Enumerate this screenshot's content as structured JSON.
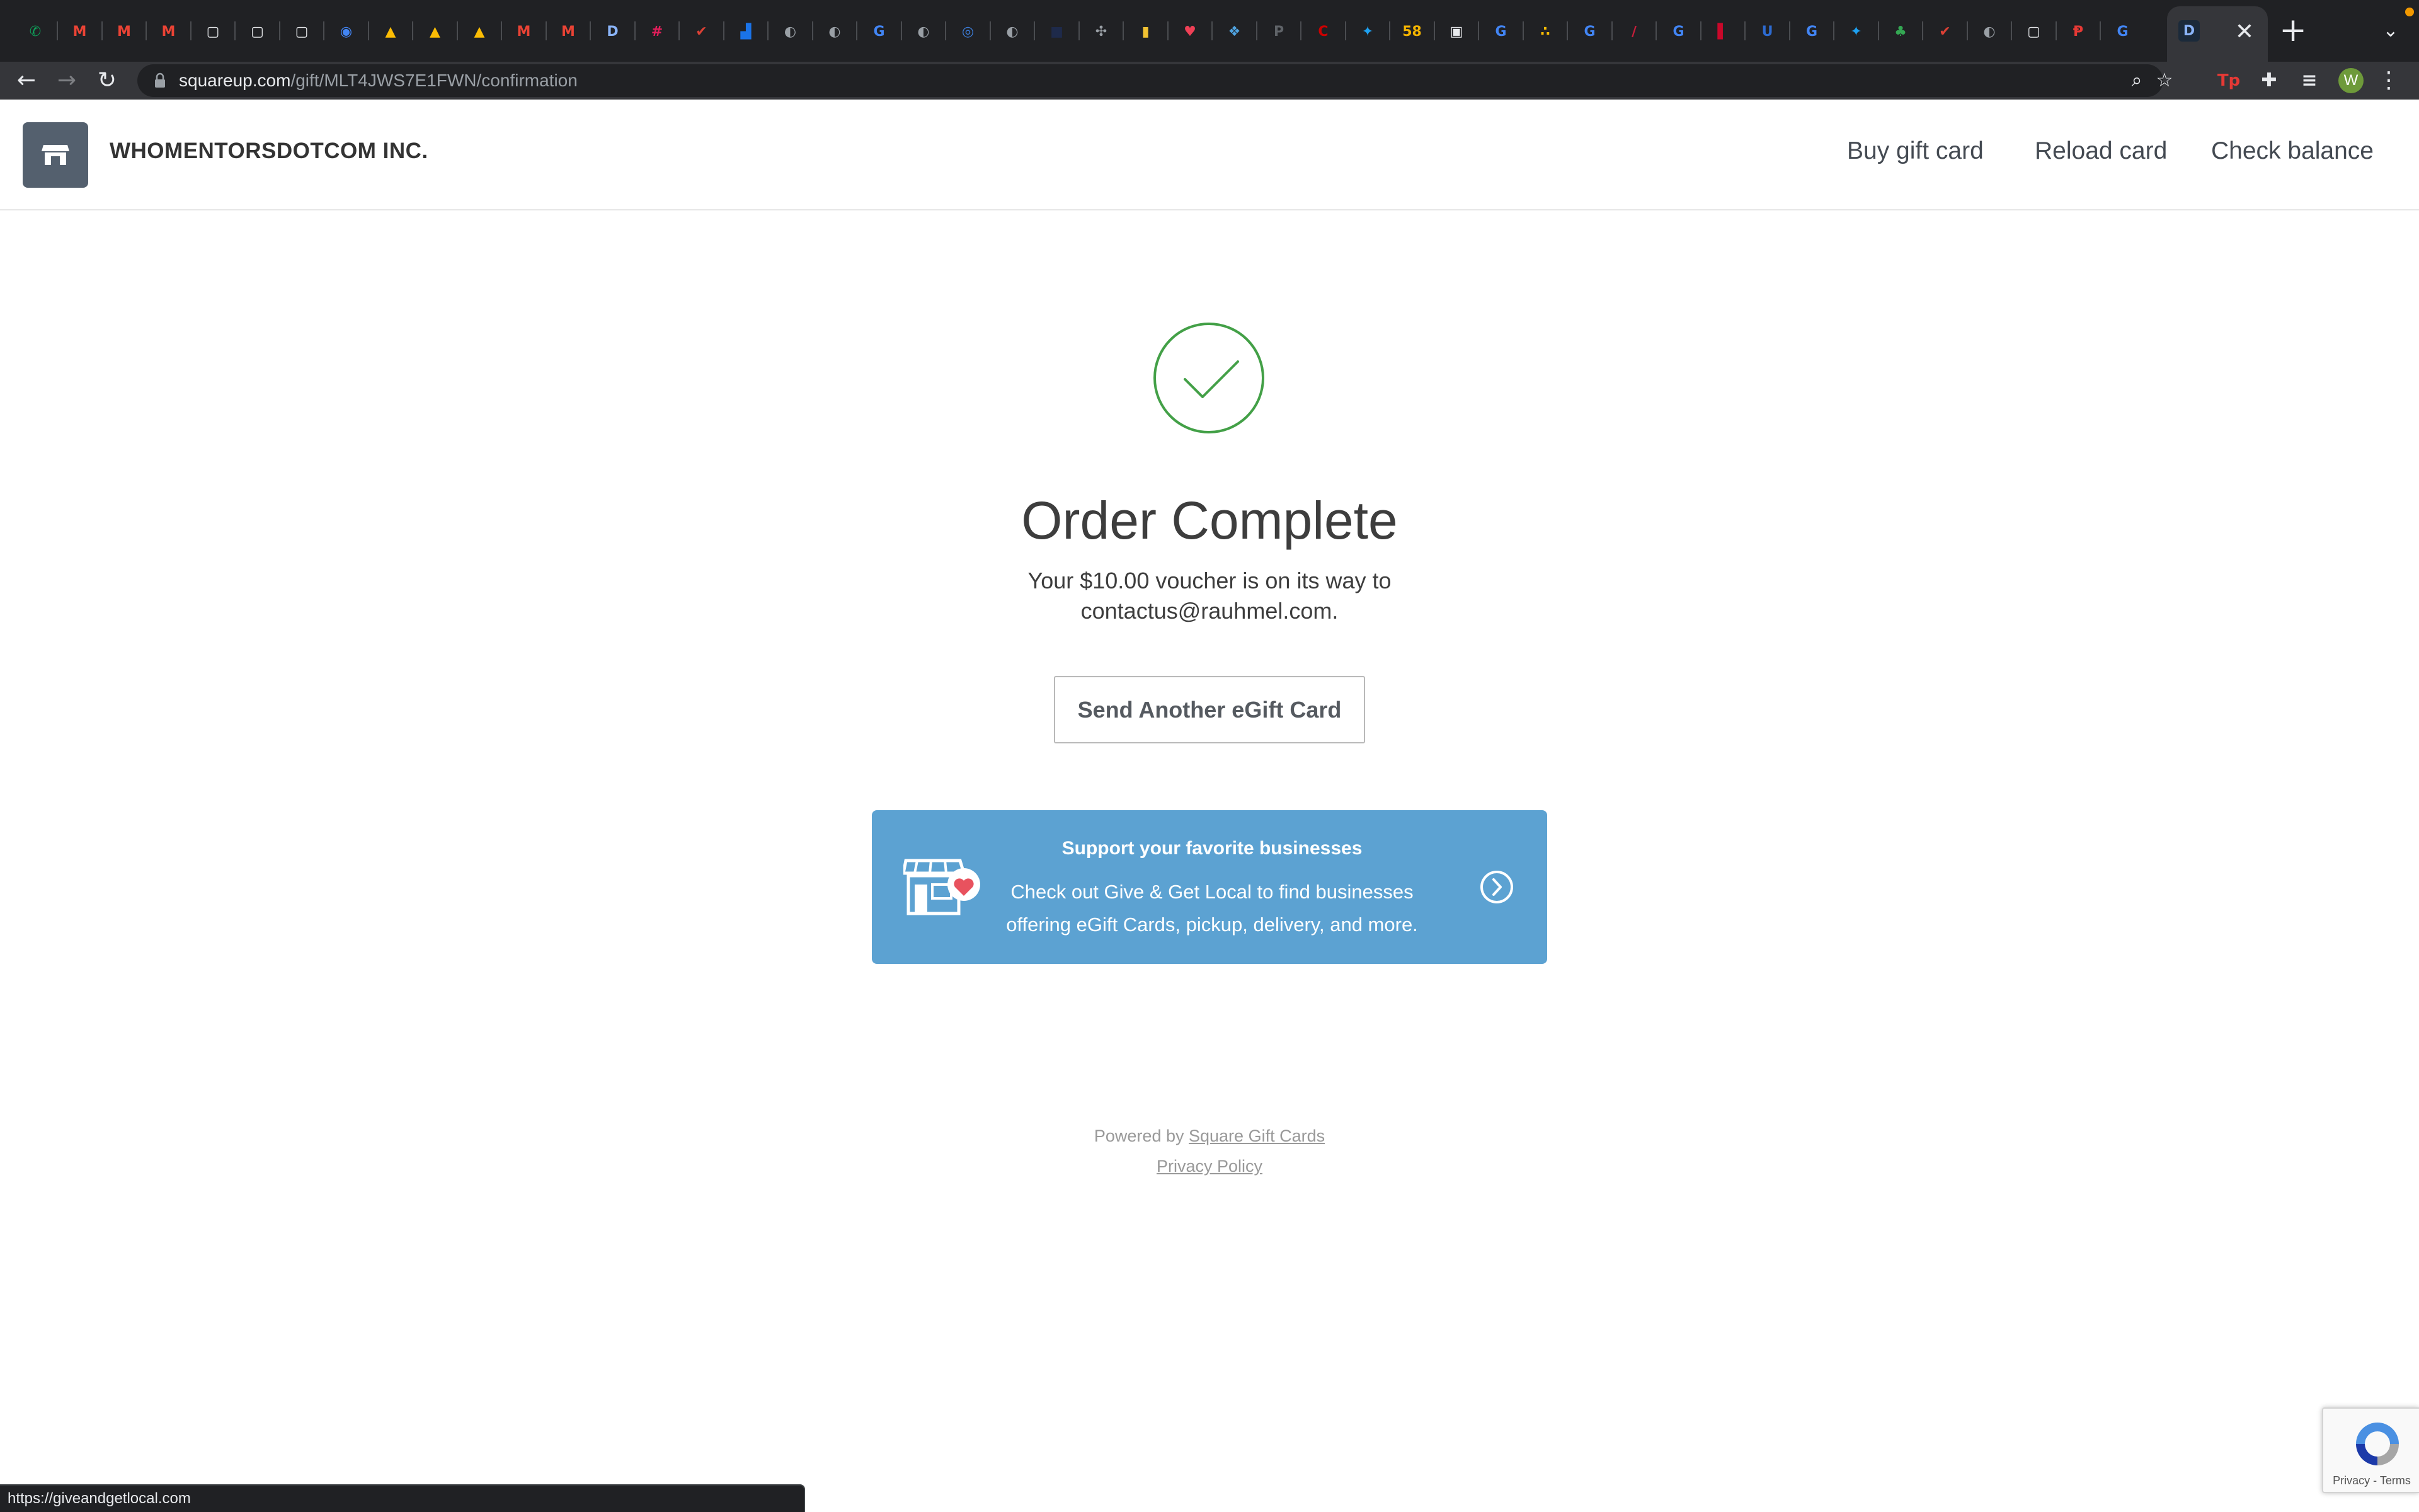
{
  "browser": {
    "tabs": [
      {
        "icon": "phone-icon",
        "glyph": "✆",
        "color": "#0f9d58"
      },
      {
        "icon": "gmail-icon",
        "glyph": "M",
        "color": "#ea4335"
      },
      {
        "icon": "gmail-icon",
        "glyph": "M",
        "color": "#ea4335"
      },
      {
        "icon": "gmail-icon",
        "glyph": "M",
        "color": "#ea4335"
      },
      {
        "icon": "square-icon",
        "glyph": "▢",
        "color": "#e8eaed"
      },
      {
        "icon": "square-icon",
        "glyph": "▢",
        "color": "#e8eaed"
      },
      {
        "icon": "square-icon",
        "glyph": "▢",
        "color": "#e8eaed"
      },
      {
        "icon": "chromium-icon",
        "glyph": "◉",
        "color": "#4285f4"
      },
      {
        "icon": "drive-icon",
        "glyph": "▲",
        "color": "#fbbc04"
      },
      {
        "icon": "drive-icon",
        "glyph": "▲",
        "color": "#fbbc04"
      },
      {
        "icon": "drive-icon",
        "glyph": "▲",
        "color": "#fbbc04"
      },
      {
        "icon": "gmail-icon",
        "glyph": "M",
        "color": "#ea4335"
      },
      {
        "icon": "gmail-icon",
        "glyph": "M",
        "color": "#ea4335"
      },
      {
        "icon": "d-icon",
        "glyph": "D",
        "color": "#8ab4f8"
      },
      {
        "icon": "slack-icon",
        "glyph": "#",
        "color": "#e01e5a"
      },
      {
        "icon": "todoist-icon",
        "glyph": "✔",
        "color": "#db4035"
      },
      {
        "icon": "analytics-icon",
        "glyph": "▟",
        "color": "#1a73e8"
      },
      {
        "icon": "globe-icon",
        "glyph": "◐",
        "color": "#9aa0a6"
      },
      {
        "icon": "globe-icon",
        "glyph": "◐",
        "color": "#9aa0a6"
      },
      {
        "icon": "google-icon",
        "glyph": "G",
        "color": "#4285f4"
      },
      {
        "icon": "globe-icon",
        "glyph": "◐",
        "color": "#9aa0a6"
      },
      {
        "icon": "swirl-icon",
        "glyph": "◎",
        "color": "#3c7dd9"
      },
      {
        "icon": "globe-icon",
        "glyph": "◐",
        "color": "#9aa0a6"
      },
      {
        "icon": "dark-square-icon",
        "glyph": "■",
        "color": "#1e2a4a"
      },
      {
        "icon": "network-icon",
        "glyph": "✣",
        "color": "#9aa0a6"
      },
      {
        "icon": "notebook-icon",
        "glyph": "▮",
        "color": "#f1c232"
      },
      {
        "icon": "pocket-icon",
        "glyph": "♥",
        "color": "#ef4056"
      },
      {
        "icon": "apps-icon",
        "glyph": "❖",
        "color": "#4fa3e0"
      },
      {
        "icon": "paypal-icon",
        "glyph": "P",
        "color": "#5f6368"
      },
      {
        "icon": "cnn-icon",
        "glyph": "C",
        "color": "#cc0000"
      },
      {
        "icon": "twitter-icon",
        "glyph": "✦",
        "color": "#1da1f2"
      },
      {
        "icon": "number-icon",
        "glyph": "58",
        "color": "#f4b400"
      },
      {
        "icon": "doc-icon",
        "glyph": "▣",
        "color": "#e8eaed"
      },
      {
        "icon": "google-icon",
        "glyph": "G",
        "color": "#4285f4"
      },
      {
        "icon": "dots-icon",
        "glyph": "∴",
        "color": "#fbbc04"
      },
      {
        "icon": "google-icon",
        "glyph": "G",
        "color": "#4285f4"
      },
      {
        "icon": "mlb-icon",
        "glyph": "∕",
        "color": "#c41e3a"
      },
      {
        "icon": "google-icon",
        "glyph": "G",
        "color": "#4285f4"
      },
      {
        "icon": "nba-icon",
        "glyph": "▌",
        "color": "#c9082a"
      },
      {
        "icon": "u-icon",
        "glyph": "U",
        "color": "#2d6bd1"
      },
      {
        "icon": "google-icon",
        "glyph": "G",
        "color": "#4285f4"
      },
      {
        "icon": "twitter-icon",
        "glyph": "✦",
        "color": "#1da1f2"
      },
      {
        "icon": "palm-icon",
        "glyph": "♣",
        "color": "#34a853"
      },
      {
        "icon": "todoist-icon",
        "glyph": "✔",
        "color": "#db4035"
      },
      {
        "icon": "globe-icon",
        "glyph": "◐",
        "color": "#9aa0a6"
      },
      {
        "icon": "square-icon",
        "glyph": "▢",
        "color": "#e8eaed"
      },
      {
        "icon": "p-icon",
        "glyph": "Ᵽ",
        "color": "#e53935"
      },
      {
        "icon": "google-icon",
        "glyph": "G",
        "color": "#4285f4"
      }
    ],
    "active_tab": {
      "icon": "d-icon",
      "glyph": "D"
    },
    "close_glyph": "✕",
    "new_tab_glyph": "+",
    "url_host": "squareup.com",
    "url_path": "/gift/MLT4JWS7E1FWN/confirmation",
    "extension_tp": "Tp",
    "avatar_letter": "W",
    "status_url": "https://giveandgetlocal.com"
  },
  "header": {
    "merchant_name": "WHOMENTORSDOTCOM INC.",
    "nav": {
      "buy": "Buy gift card",
      "reload": "Reload card",
      "balance": "Check balance"
    }
  },
  "main": {
    "title": "Order Complete",
    "message_line1": "Your $10.00 voucher is on its way to",
    "message_line2": "contactus@rauhmel.com.",
    "send_button": "Send Another eGift Card"
  },
  "promo": {
    "title": "Support your favorite businesses",
    "body_line1": "Check out Give & Get Local to find businesses",
    "body_line2": "offering eGift Cards, pickup, delivery, and more.",
    "color": "#5ca2d2"
  },
  "footer": {
    "powered_prefix": "Powered by",
    "powered_link": "Square Gift Cards",
    "privacy": "Privacy Policy"
  },
  "recaptcha": {
    "text": "Privacy - Terms"
  },
  "colors": {
    "check_green": "#43a047",
    "brand_slate": "#54606e"
  }
}
